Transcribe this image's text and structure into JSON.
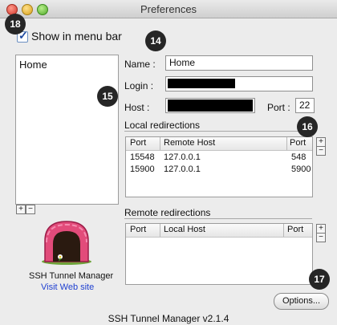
{
  "window": {
    "title": "Preferences"
  },
  "badges": [
    "18",
    "14",
    "15",
    "16",
    "17"
  ],
  "show_in_menu_bar": {
    "label": "Show in menu bar",
    "checked": true
  },
  "sidebar": {
    "items": [
      {
        "label": "Home"
      }
    ],
    "add": "+",
    "remove": "−"
  },
  "form": {
    "name_label": "Name :",
    "name_value": "Home",
    "login_label": "Login :",
    "host_label": "Host :",
    "port_label": "Port :",
    "port_value": "22"
  },
  "local_redirections": {
    "title": "Local redirections",
    "columns": [
      "Port",
      "Remote Host",
      "Port"
    ],
    "rows": [
      {
        "port": "15548",
        "host": "127.0.0.1",
        "remote_port": "548"
      },
      {
        "port": "15900",
        "host": "127.0.0.1",
        "remote_port": "5900"
      }
    ],
    "add": "+",
    "remove": "−"
  },
  "remote_redirections": {
    "title": "Remote redirections",
    "columns": [
      "Port",
      "Local Host",
      "Port"
    ],
    "add": "+",
    "remove": "−"
  },
  "app": {
    "name": "SSH Tunnel Manager",
    "link": "Visit Web site"
  },
  "options_button": "Options...",
  "footer": "SSH Tunnel Manager v2.1.4"
}
